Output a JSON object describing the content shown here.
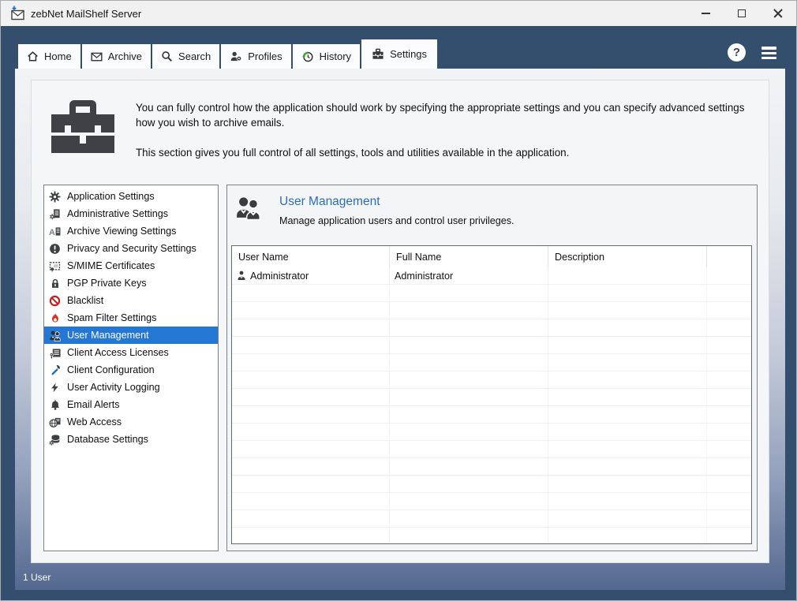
{
  "window": {
    "title": "zebNet MailShelf Server"
  },
  "tabs": [
    {
      "label": "Home",
      "icon": "home-icon",
      "active": false
    },
    {
      "label": "Archive",
      "icon": "envelope-icon",
      "active": false
    },
    {
      "label": "Search",
      "icon": "search-icon",
      "active": false
    },
    {
      "label": "Profiles",
      "icon": "profile-gear-icon",
      "active": false
    },
    {
      "label": "History",
      "icon": "history-clock-icon",
      "active": false
    },
    {
      "label": "Settings",
      "icon": "toolbox-icon",
      "active": true
    }
  ],
  "top_right": {
    "help_glyph": "?"
  },
  "page_header": {
    "intro1": "You can fully control how the application should work by specifying the appropriate settings and you can specify advanced settings how you wish to archive emails.",
    "intro2": "This section gives you full control of all settings, tools and utilities available in the application."
  },
  "sidebar": {
    "items": [
      {
        "label": "Application Settings",
        "icon": "gear-icon",
        "selected": false
      },
      {
        "label": "Administrative Settings",
        "icon": "admin-gear-doc-icon",
        "selected": false
      },
      {
        "label": "Archive Viewing Settings",
        "icon": "archive-view-icon",
        "selected": false
      },
      {
        "label": "Privacy and Security Settings",
        "icon": "privacy-alert-icon",
        "selected": false
      },
      {
        "label": "S/MIME Certificates",
        "icon": "certificate-icon",
        "selected": false
      },
      {
        "label": "PGP Private Keys",
        "icon": "lock-icon",
        "selected": false
      },
      {
        "label": "Blacklist",
        "icon": "blocked-icon",
        "selected": false
      },
      {
        "label": "Spam Filter Settings",
        "icon": "flame-icon",
        "selected": false
      },
      {
        "label": "User Management",
        "icon": "users-icon",
        "selected": true
      },
      {
        "label": "Client Access Licenses",
        "icon": "license-key-icon",
        "selected": false
      },
      {
        "label": "Client Configuration",
        "icon": "wrench-icon",
        "selected": false
      },
      {
        "label": "User Activity Logging",
        "icon": "lightning-icon",
        "selected": false
      },
      {
        "label": "Email Alerts",
        "icon": "bell-icon",
        "selected": false
      },
      {
        "label": "Web Access",
        "icon": "globe-icon",
        "selected": false
      },
      {
        "label": "Database Settings",
        "icon": "database-icon",
        "selected": false
      }
    ]
  },
  "panel": {
    "title": "User Management",
    "subtitle": "Manage application users and control user privileges.",
    "table": {
      "columns": [
        "User Name",
        "Full Name",
        "Description",
        ""
      ],
      "rows": [
        {
          "user_name": "Administrator",
          "full_name": "Administrator",
          "description": ""
        }
      ],
      "empty_rows": 16
    }
  },
  "status_bar": {
    "text": "1 User"
  },
  "colors": {
    "chrome_blue": "#344e6e",
    "selection_blue": "#2577d4",
    "panel_title_blue": "#2a6db8",
    "blacklist_red": "#c9201d",
    "flame_red": "#d03528"
  }
}
